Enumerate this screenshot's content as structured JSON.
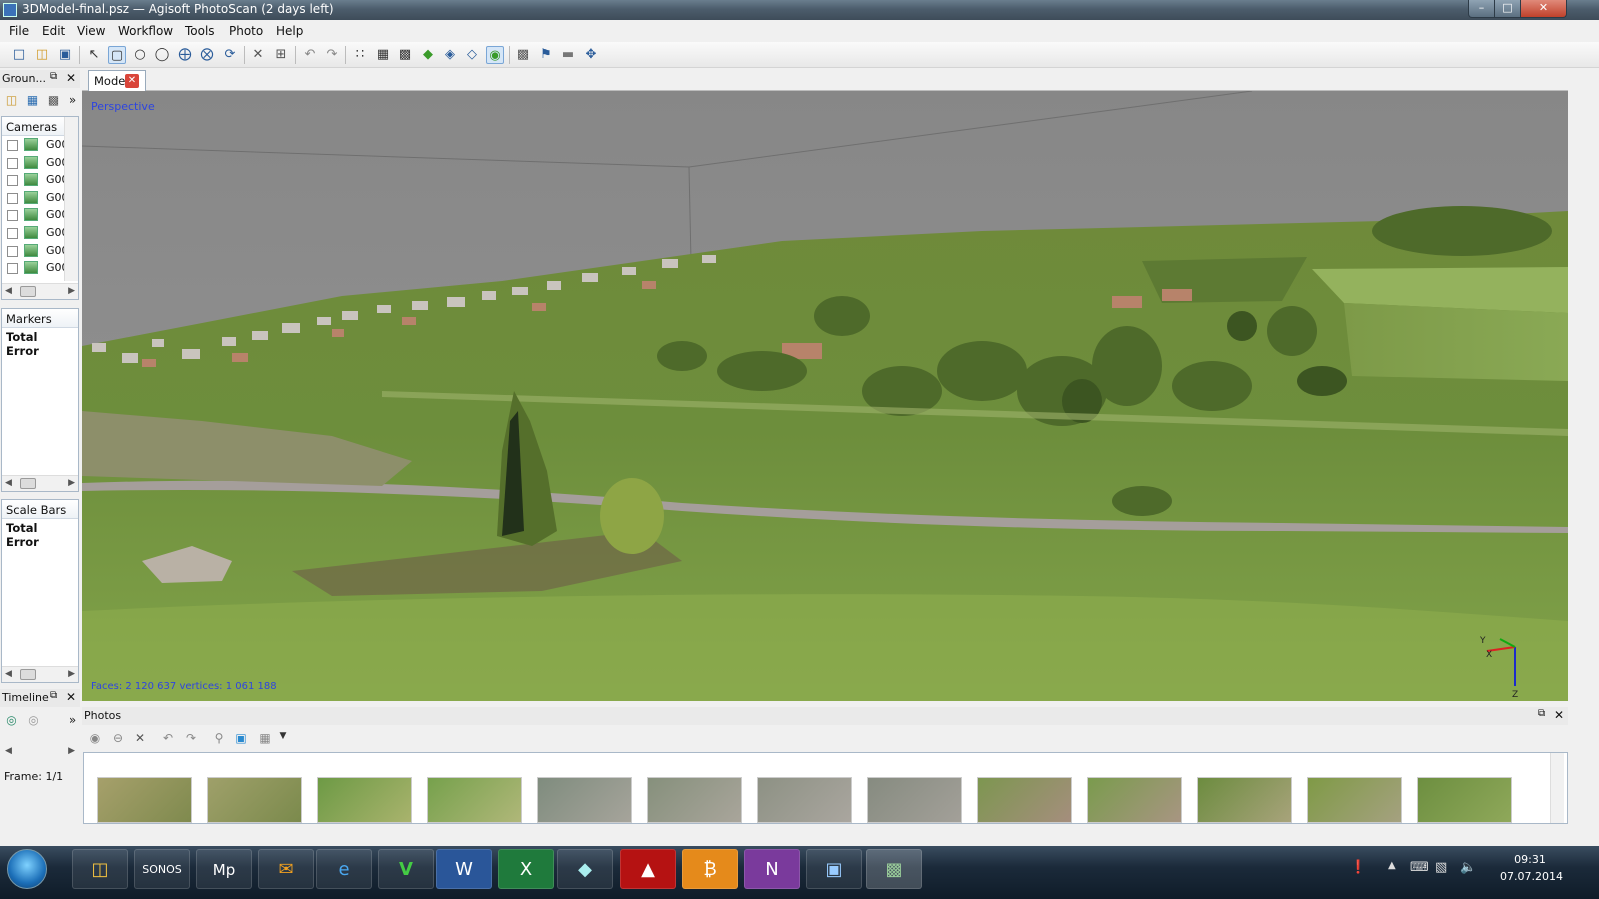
{
  "window": {
    "title": "3DModel-final.psz — Agisoft PhotoScan (2 days left)"
  },
  "menu": [
    "File",
    "Edit",
    "View",
    "Workflow",
    "Tools",
    "Photo",
    "Help"
  ],
  "toolbar": {
    "icons": [
      "new-icon",
      "open-icon",
      "save-icon",
      "select-icon",
      "rect-select-icon",
      "circle-select-icon",
      "free-select-icon",
      "zoom-in-icon",
      "zoom-out-icon",
      "rotate-icon",
      "delete-icon",
      "crop-icon",
      "undo-icon",
      "redo-icon",
      "points-icon",
      "dense-icon",
      "mesh-icon",
      "solid-icon",
      "wireframe-icon",
      "shaded-icon",
      "textured-icon",
      "camera-icon",
      "flag-icon",
      "ruler-icon",
      "navigate-icon"
    ]
  },
  "ground_panel": {
    "title": "Groun...",
    "cameras_header": "Cameras",
    "cameras": [
      "G00",
      "G00",
      "G00",
      "G00",
      "G00",
      "G00",
      "G00",
      "G00"
    ],
    "markers_header": "Markers",
    "markers_total": "Total Error",
    "scalebars_header": "Scale Bars",
    "scalebars_total": "Total Error"
  },
  "timeline_panel": {
    "title": "Timeline",
    "frame": "Frame: 1/1"
  },
  "model": {
    "tab_label": "Model",
    "view_mode": "Perspective",
    "stats": "Faces: 2 120 637 vertices: 1 061 188"
  },
  "photos": {
    "title": "Photos",
    "thumbnails": [
      "field-1",
      "field-2",
      "field-3",
      "field-4",
      "town-1",
      "town-2",
      "town-3",
      "town-4",
      "town-5",
      "town-6",
      "mix-1",
      "mix-2",
      "field-5"
    ]
  },
  "taskbar": {
    "apps": [
      "explorer",
      "sonos",
      "mp",
      "outlook",
      "ie",
      "vim",
      "word",
      "excel",
      "blue-app",
      "acrobat",
      "bitcoin",
      "onenote",
      "video",
      "photoscan"
    ],
    "time": "09:31",
    "date": "07.07.2014"
  }
}
